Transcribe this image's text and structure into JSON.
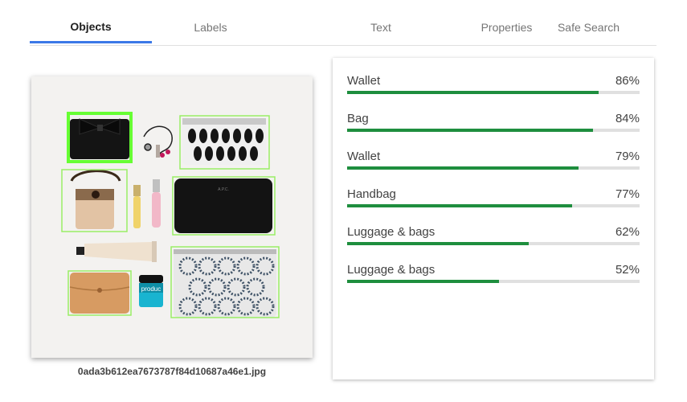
{
  "tabs": [
    {
      "label": "Objects",
      "active": true
    },
    {
      "label": "Labels",
      "active": false
    },
    {
      "label": "Text",
      "active": false
    },
    {
      "label": "Properties",
      "active": false
    },
    {
      "label": "Safe Search",
      "active": false
    }
  ],
  "image": {
    "filename": "0ada3b612ea7673787f84d10687a46e1.jpg",
    "product_label": "produc",
    "brand_small": "A.P.C."
  },
  "objects": [
    {
      "name": "Wallet",
      "score": 86
    },
    {
      "name": "Bag",
      "score": 84
    },
    {
      "name": "Wallet",
      "score": 79
    },
    {
      "name": "Handbag",
      "score": 77
    },
    {
      "name": "Luggage & bags",
      "score": 62
    },
    {
      "name": "Luggage & bags",
      "score": 52
    }
  ],
  "colors": {
    "accent": "#3b78e7",
    "bar_fill": "#1e8e3e",
    "bar_track": "#e0e0e0",
    "box_highlight": "#66ff33",
    "box": "#99ee66"
  }
}
